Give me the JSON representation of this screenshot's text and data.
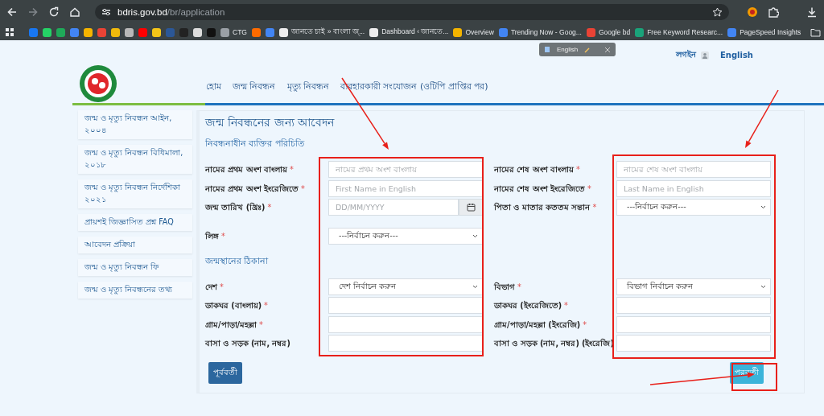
{
  "browser": {
    "url_host": "bdris.gov.bd",
    "url_path": "/br/application",
    "bookmarks": [
      {
        "color": "#1877f2"
      },
      {
        "color": "#25d366"
      },
      {
        "color": "#1faa59"
      },
      {
        "color": "#4285f4"
      },
      {
        "color": "#f5b400"
      },
      {
        "color": "#ea4335"
      },
      {
        "color": "#f0b90b"
      },
      {
        "color": "#b8b8b8"
      },
      {
        "color": "#ff0000"
      },
      {
        "color": "#f5c518"
      },
      {
        "color": "#2b5797"
      },
      {
        "color": "#222222"
      },
      {
        "color": "#dddddd"
      },
      {
        "color": "#111111"
      },
      {
        "label": "CTG",
        "color": "#9aa0a6"
      },
      {
        "color": "#ff6b00"
      },
      {
        "color": "#4285f4"
      },
      {
        "label": "জানতে চাই » বাংলা জ্...",
        "color": "#eeeeee"
      },
      {
        "label": "Dashboard ‹ জানতে...",
        "color": "#eeeeee"
      },
      {
        "label": "Overview",
        "color": "#f4b400"
      },
      {
        "label": "Trending Now - Goog...",
        "color": "#4285f4"
      },
      {
        "label": "Google bd",
        "color": "#ea4335"
      },
      {
        "label": "Free Keyword Researc...",
        "color": "#1aa37a"
      },
      {
        "label": "PageSpeed Insights",
        "color": "#4285f4"
      }
    ]
  },
  "translate_popup": {
    "language": "English"
  },
  "header": {
    "login": "লগইন",
    "language_link": "English",
    "nav": [
      "হোম",
      "জন্ম নিবন্ধন",
      "মৃত্যু নিবন্ধন",
      "ব্যবহারকারী সংযোজন (ওটিপি প্রাপ্তির পর)"
    ]
  },
  "sidebar": {
    "items": [
      "জন্ম ও মৃত্যু নিবন্ধন আইন, ২০০৪",
      "জন্ম ও মৃত্যু নিবন্ধন বিধিমালা, ২০১৮",
      "জন্ম ও মৃত্যু নিবন্ধন নির্দেশিকা ২০২১",
      "প্রায়শই জিজ্ঞাসিত প্রশ্ন FAQ",
      "আবেদন প্রক্রিয়া",
      "জন্ম ও মৃত্যু নিবন্ধন ফি",
      "জন্ম ও মৃত্যু নিবন্ধনের তথ্য"
    ]
  },
  "form": {
    "title": "জন্ম নিবন্ধনের জন্য আবেদন",
    "sections": [
      {
        "heading": "নিবন্ধনাধীন ব্যক্তির পরিচিতি",
        "rows": [
          [
            {
              "label": "নামের প্রথম অংশ বাংলায়",
              "marker": "*",
              "kind": "text",
              "placeholder": "নামের প্রথম অংশ বাংলায়"
            },
            {
              "label": "নামের শেষ অংশ বাংলায়",
              "marker": "*",
              "kind": "text",
              "placeholder": "নামের শেষ অংশ বাংলায়"
            }
          ],
          [
            {
              "label": "নামের প্রথম অংশ ইংরেজিতে",
              "marker": "*",
              "kind": "text",
              "placeholder": "First Name in English"
            },
            {
              "label": "নামের শেষ অংশ ইংরেজিতে",
              "marker": "*",
              "kind": "text",
              "placeholder": "Last Name in English"
            }
          ],
          [
            {
              "label": "জন্ম তারিখ (খ্রিঃ)",
              "marker": "*",
              "kind": "date",
              "placeholder": "DD/MM/YYYY"
            },
            {
              "label": "পিতা ও মাতার কততম সন্তান",
              "marker": "*",
              "kind": "select",
              "value": "---নির্বাচন করুন---"
            }
          ],
          [
            {
              "label": "লিঙ্গ",
              "marker": "*",
              "kind": "select",
              "value": "---নির্বাচন করুন---"
            }
          ]
        ]
      },
      {
        "heading": "জন্মস্থানের ঠিকানা",
        "rows": [
          [
            {
              "label": "দেশ",
              "marker": "*",
              "kind": "select",
              "value": "দেশ নির্বাচন করুন"
            },
            {
              "label": "বিভাগ",
              "marker": "*",
              "kind": "select",
              "value": "বিভাগ নির্বাচন করুন"
            }
          ],
          [
            {
              "label": "ডাকঘর (বাংলায়)",
              "marker": "*",
              "kind": "text"
            },
            {
              "label": "ডাকঘর (ইংরেজিতে)",
              "marker": "*",
              "kind": "text"
            }
          ],
          [
            {
              "label": "গ্রাম/পাড়া/মহল্লা",
              "marker": "*",
              "kind": "text"
            },
            {
              "label": "গ্রাম/পাড়া/মহল্লা (ইংরেজি)",
              "marker": "*",
              "kind": "text"
            }
          ],
          [
            {
              "label": "বাসা ও সড়ক (নাম, নম্বর)",
              "kind": "text"
            },
            {
              "label": "বাসা ও সড়ক (নাম, নম্বর) (ইংরেজি)",
              "kind": "text"
            }
          ]
        ]
      }
    ],
    "buttons": [
      {
        "label": "পূর্ববর্তী",
        "kind": "previous"
      },
      {
        "label": "পরবর্তী",
        "kind": "next"
      }
    ]
  }
}
